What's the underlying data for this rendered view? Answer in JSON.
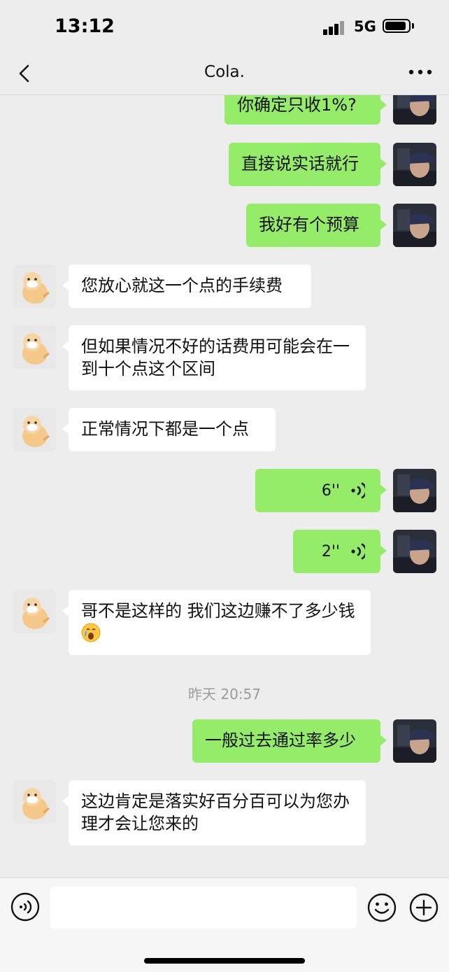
{
  "status_bar": {
    "time": "13:12",
    "network": "5G"
  },
  "header": {
    "title": "Cola."
  },
  "messages": [
    {
      "side": "out",
      "type": "text",
      "text": "你确定只收1%?"
    },
    {
      "side": "out",
      "type": "text",
      "text": "直接说实话就行"
    },
    {
      "side": "out",
      "type": "text",
      "text": "我好有个预算"
    },
    {
      "side": "in",
      "type": "text",
      "text": "您放心就这一个点的手续费"
    },
    {
      "side": "in",
      "type": "text",
      "text": "但如果情况不好的话费用可能会在一到十个点这个区间"
    },
    {
      "side": "in",
      "type": "text",
      "text": "正常情况下都是一个点"
    },
    {
      "side": "out",
      "type": "voice",
      "duration": "6''"
    },
    {
      "side": "out",
      "type": "voice",
      "duration": "2''"
    },
    {
      "side": "in",
      "type": "text",
      "text": "哥不是这样的 我们这边赚不了多少钱"
    },
    {
      "side": "out",
      "type": "text",
      "text": "一般过去通过率多少"
    },
    {
      "side": "in",
      "type": "text",
      "text": "这边肯定是落实好百分百可以为您办理才会让您来的"
    }
  ],
  "timestamps": [
    "昨天 20:57"
  ],
  "icons": {
    "back": "chevron-left-icon",
    "more": "more-dots-icon",
    "voice_toggle": "voice-icon",
    "emoji": "emoji-icon",
    "plus": "plus-icon",
    "voice_message": "voice-wave-icon",
    "inline_emoji": "cry-emoji-icon"
  },
  "colors": {
    "outgoing_bubble": "#95ec69",
    "incoming_bubble": "#ffffff",
    "background": "#ededed"
  }
}
